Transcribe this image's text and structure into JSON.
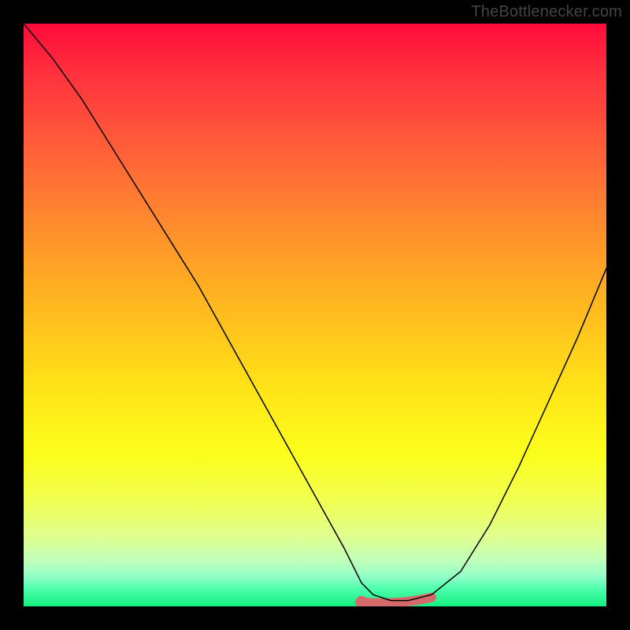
{
  "attribution": "TheBottlenecker.com",
  "chart_data": {
    "type": "line",
    "title": "",
    "xlabel": "",
    "ylabel": "",
    "xlim": [
      0,
      100
    ],
    "ylim": [
      0,
      100
    ],
    "series": [
      {
        "name": "bottleneck-curve",
        "x": [
          0,
          5,
          10,
          15,
          20,
          25,
          30,
          35,
          40,
          45,
          50,
          55,
          58,
          60,
          63,
          66,
          70,
          75,
          80,
          85,
          90,
          95,
          100
        ],
        "y": [
          100,
          94,
          87,
          79,
          71,
          63,
          55,
          46,
          37,
          28,
          19,
          10,
          4,
          2,
          1,
          1,
          2,
          6,
          14,
          24,
          35,
          46,
          58
        ]
      }
    ],
    "highlight": {
      "name": "optimal-zone",
      "x_start": 58,
      "x_end": 70,
      "y": 1,
      "color": "#d46a6a"
    },
    "background_gradient": {
      "stops": [
        {
          "pos": 0,
          "color": "#ff0b3a"
        },
        {
          "pos": 8,
          "color": "#ff2f3e"
        },
        {
          "pos": 20,
          "color": "#ff5a3a"
        },
        {
          "pos": 34,
          "color": "#ff8a2e"
        },
        {
          "pos": 48,
          "color": "#ffb71f"
        },
        {
          "pos": 62,
          "color": "#ffe218"
        },
        {
          "pos": 74,
          "color": "#fbff1c"
        },
        {
          "pos": 82,
          "color": "#f1ff54"
        },
        {
          "pos": 88,
          "color": "#dfff8f"
        },
        {
          "pos": 92,
          "color": "#c3ffba"
        },
        {
          "pos": 95,
          "color": "#8fffc7"
        },
        {
          "pos": 97,
          "color": "#4dffad"
        },
        {
          "pos": 100,
          "color": "#12f07f"
        }
      ]
    }
  }
}
